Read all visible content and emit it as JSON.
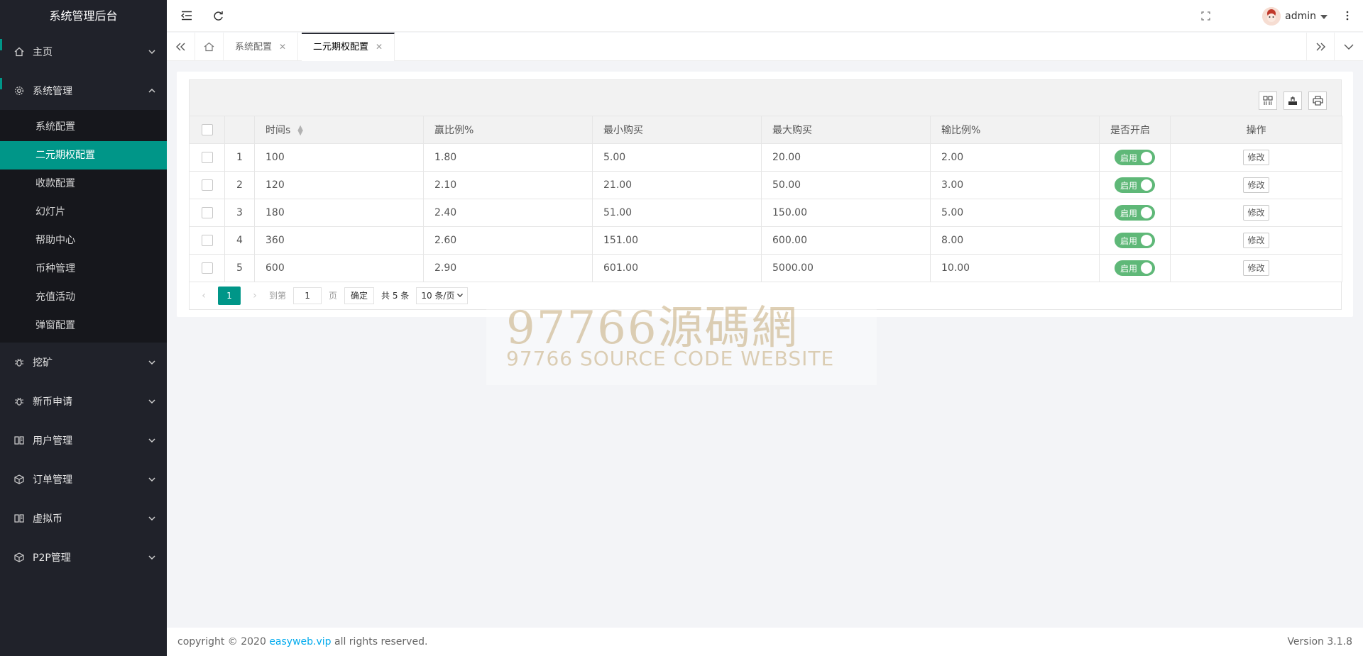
{
  "app": {
    "title": "系统管理后台"
  },
  "header": {
    "user": "admin"
  },
  "sidebar": {
    "groups": [
      {
        "label": "主页",
        "icon": "home-icon"
      },
      {
        "label": "系统管理",
        "icon": "gear-icon",
        "items": [
          {
            "label": "系统配置"
          },
          {
            "label": "二元期权配置"
          },
          {
            "label": "收款配置"
          },
          {
            "label": "幻灯片"
          },
          {
            "label": "帮助中心"
          },
          {
            "label": "币种管理"
          },
          {
            "label": "充值活动"
          },
          {
            "label": "弹窗配置"
          }
        ]
      },
      {
        "label": "挖矿",
        "icon": "bug-icon"
      },
      {
        "label": "新币申请",
        "icon": "bug-icon"
      },
      {
        "label": "用户管理",
        "icon": "read-icon"
      },
      {
        "label": "订单管理",
        "icon": "cube-icon"
      },
      {
        "label": "虚拟币",
        "icon": "read-icon"
      },
      {
        "label": "P2P管理",
        "icon": "cube-icon"
      }
    ]
  },
  "tabs": [
    {
      "label": "系统配置"
    },
    {
      "label": "二元期权配置"
    }
  ],
  "table": {
    "columns": [
      "时间s",
      "赢比例%",
      "最小购买",
      "最大购买",
      "输比例%",
      "是否开启",
      "操作"
    ],
    "rows": [
      {
        "n": "1",
        "time": "100",
        "win": "1.80",
        "min": "5.00",
        "max": "20.00",
        "lose": "2.00"
      },
      {
        "n": "2",
        "time": "120",
        "win": "2.10",
        "min": "21.00",
        "max": "50.00",
        "lose": "3.00"
      },
      {
        "n": "3",
        "time": "180",
        "win": "2.40",
        "min": "51.00",
        "max": "150.00",
        "lose": "5.00"
      },
      {
        "n": "4",
        "time": "360",
        "win": "2.60",
        "min": "151.00",
        "max": "600.00",
        "lose": "8.00"
      },
      {
        "n": "5",
        "time": "600",
        "win": "2.90",
        "min": "601.00",
        "max": "5000.00",
        "lose": "10.00"
      }
    ],
    "switch_label": "启用",
    "edit_label": "修改"
  },
  "pager": {
    "current": "1",
    "goto_label": "到第",
    "goto_value": "1",
    "page_unit": "页",
    "confirm": "确定",
    "total": "共 5 条",
    "per_page": "10 条/页"
  },
  "watermark": {
    "cn": "97766源碼網",
    "en": "97766 SOURCE CODE WEBSITE"
  },
  "footer": {
    "prefix": "copyright © 2020 ",
    "link": "easyweb.vip",
    "suffix": " all rights reserved.",
    "version": "Version 3.1.8"
  },
  "colors": {
    "accent": "#009688",
    "switch_on": "#5fb878",
    "sidebar_bg": "#20222a"
  }
}
